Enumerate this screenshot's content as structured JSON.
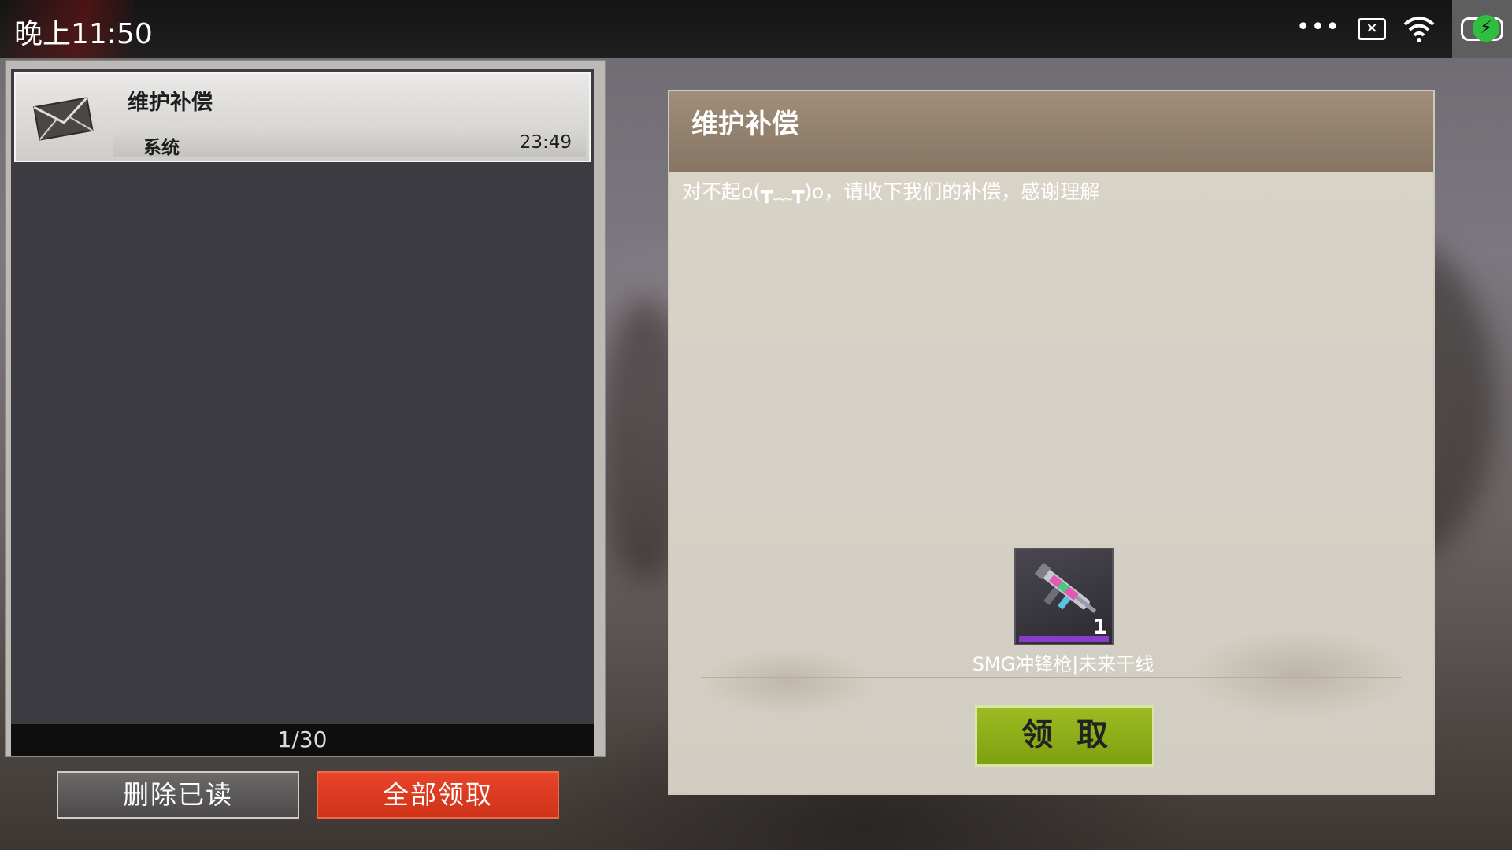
{
  "status_bar": {
    "time": "晚上11:50",
    "icons": [
      "more-dots-icon",
      "notification-box-icon",
      "wifi-icon",
      "battery-charging-icon"
    ]
  },
  "mail_list": {
    "items": [
      {
        "title": "维护补偿",
        "sender": "系统",
        "time": "23:49",
        "icon": "envelope-icon"
      }
    ],
    "pager": "1/30"
  },
  "actions": {
    "delete_read": "删除已读",
    "claim_all": "全部领取"
  },
  "detail": {
    "title": "维护补偿",
    "body": "对不起o(┳﹏┳)o，请收下我们的补偿，感谢理解",
    "reward": {
      "name": "SMG冲锋枪|未来干线",
      "quantity": "1",
      "icon": "smg-gun-icon",
      "rarity_color": "#8a3cc8"
    },
    "claim_button": "领取"
  },
  "colors": {
    "claim_all_button": "#e03c22",
    "claim_button": "#8fae18",
    "header": "#94826f"
  }
}
